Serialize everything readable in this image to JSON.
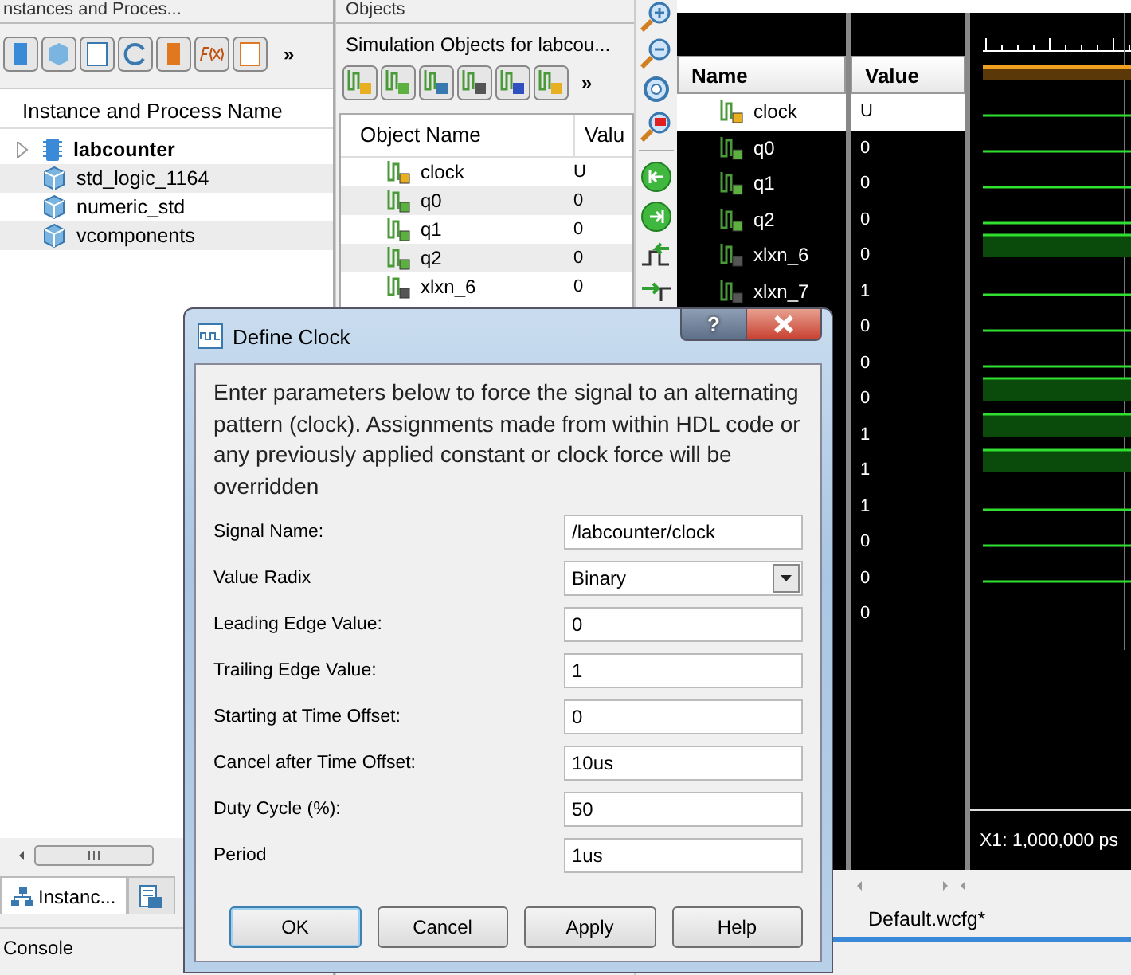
{
  "instances_panel": {
    "title": "nstances and Proces...",
    "toolbar_more": "»",
    "column": "Instance and Process Name",
    "items": [
      {
        "name": "labcounter",
        "kind": "module",
        "expanded": false
      },
      {
        "name": "std_logic_1164",
        "kind": "package"
      },
      {
        "name": "numeric_std",
        "kind": "package"
      },
      {
        "name": "vcomponents",
        "kind": "package"
      }
    ],
    "tabs": [
      {
        "kind": "labeled",
        "label": "Instanc...",
        "selected": true
      },
      {
        "kind": "icon",
        "selected": false
      }
    ],
    "console": "Console"
  },
  "objects_panel": {
    "title": "Objects",
    "subtitle": "Simulation Objects for labcou...",
    "toolbar_more": "»",
    "columns": [
      "Object Name",
      "Valu"
    ],
    "rows": [
      {
        "name": "clock",
        "value": "U",
        "kind": "input"
      },
      {
        "name": "q0",
        "value": "0",
        "kind": "output"
      },
      {
        "name": "q1",
        "value": "0",
        "kind": "output"
      },
      {
        "name": "q2",
        "value": "0",
        "kind": "output"
      },
      {
        "name": "xlxn_6",
        "value": "0",
        "kind": "internal"
      }
    ]
  },
  "wave_window": {
    "columns": [
      "Name",
      "Value"
    ],
    "signals": [
      {
        "name": "clock",
        "value": "U",
        "kind": "input",
        "selected": true
      },
      {
        "name": "q0",
        "value": "0",
        "kind": "output",
        "selected": false
      },
      {
        "name": "q1",
        "value": "0",
        "kind": "output",
        "selected": false
      },
      {
        "name": "q2",
        "value": "0",
        "kind": "output",
        "selected": false
      },
      {
        "name": "xlxn_6",
        "value": "0",
        "kind": "internal",
        "selected": false
      },
      {
        "name": "xlxn_7",
        "value": "1",
        "kind": "internal",
        "selected": false
      },
      {
        "value": "0"
      },
      {
        "value": "0"
      },
      {
        "value": "0"
      },
      {
        "value": "1"
      },
      {
        "value": "1"
      },
      {
        "value": "1"
      },
      {
        "value": "0"
      },
      {
        "value": "0"
      },
      {
        "value": "0"
      }
    ],
    "cursor": "X1: 1,000,000 ps",
    "tab": "Default.wcfg*"
  },
  "dialog": {
    "title": "Define Clock",
    "help_glyph": "?",
    "description": "Enter parameters below to force the signal to an alternating pattern (clock). Assignments made from within HDL code or any previously applied constant or clock force will be overridden",
    "fields": [
      {
        "label": "Signal Name:",
        "value": "/labcounter/clock",
        "kind": "text"
      },
      {
        "label": "Value Radix",
        "value": "Binary",
        "kind": "select"
      },
      {
        "label": "Leading Edge Value:",
        "value": "0",
        "kind": "text"
      },
      {
        "label": "Trailing Edge Value:",
        "value": "1",
        "kind": "text"
      },
      {
        "label": "Starting at Time Offset:",
        "value": "0",
        "kind": "text"
      },
      {
        "label": "Cancel after Time Offset:",
        "value": "10us",
        "kind": "text"
      },
      {
        "label": "Duty Cycle (%):",
        "value": "50",
        "kind": "text"
      },
      {
        "label": "Period",
        "value": "1us",
        "kind": "text"
      }
    ],
    "buttons": [
      {
        "label": "OK",
        "default": true
      },
      {
        "label": "Cancel",
        "default": false
      },
      {
        "label": "Apply",
        "default": false
      },
      {
        "label": "Help",
        "default": false
      }
    ]
  }
}
